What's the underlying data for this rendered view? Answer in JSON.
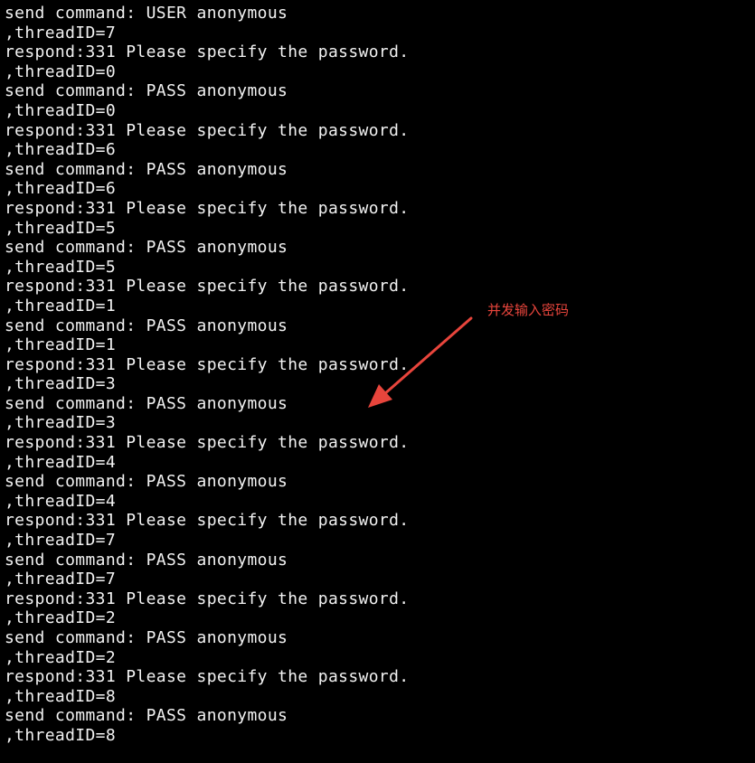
{
  "terminal": {
    "lines": [
      "send command: USER anonymous",
      ",threadID=7",
      "respond:331 Please specify the password.",
      ",threadID=0",
      "send command: PASS anonymous",
      ",threadID=0",
      "respond:331 Please specify the password.",
      ",threadID=6",
      "send command: PASS anonymous",
      ",threadID=6",
      "respond:331 Please specify the password.",
      ",threadID=5",
      "send command: PASS anonymous",
      ",threadID=5",
      "respond:331 Please specify the password.",
      ",threadID=1",
      "send command: PASS anonymous",
      ",threadID=1",
      "respond:331 Please specify the password.",
      ",threadID=3",
      "send command: PASS anonymous",
      ",threadID=3",
      "respond:331 Please specify the password.",
      ",threadID=4",
      "send command: PASS anonymous",
      ",threadID=4",
      "respond:331 Please specify the password.",
      ",threadID=7",
      "send command: PASS anonymous",
      ",threadID=7",
      "respond:331 Please specify the password.",
      ",threadID=2",
      "send command: PASS anonymous",
      ",threadID=2",
      "respond:331 Please specify the password.",
      ",threadID=8",
      "send command: PASS anonymous",
      ",threadID=8"
    ],
    "background_color": "#000000",
    "text_color": "#f2f2f2"
  },
  "annotation": {
    "text": "并发输入密码",
    "color": "#e8453c",
    "icon": "arrow-icon"
  }
}
